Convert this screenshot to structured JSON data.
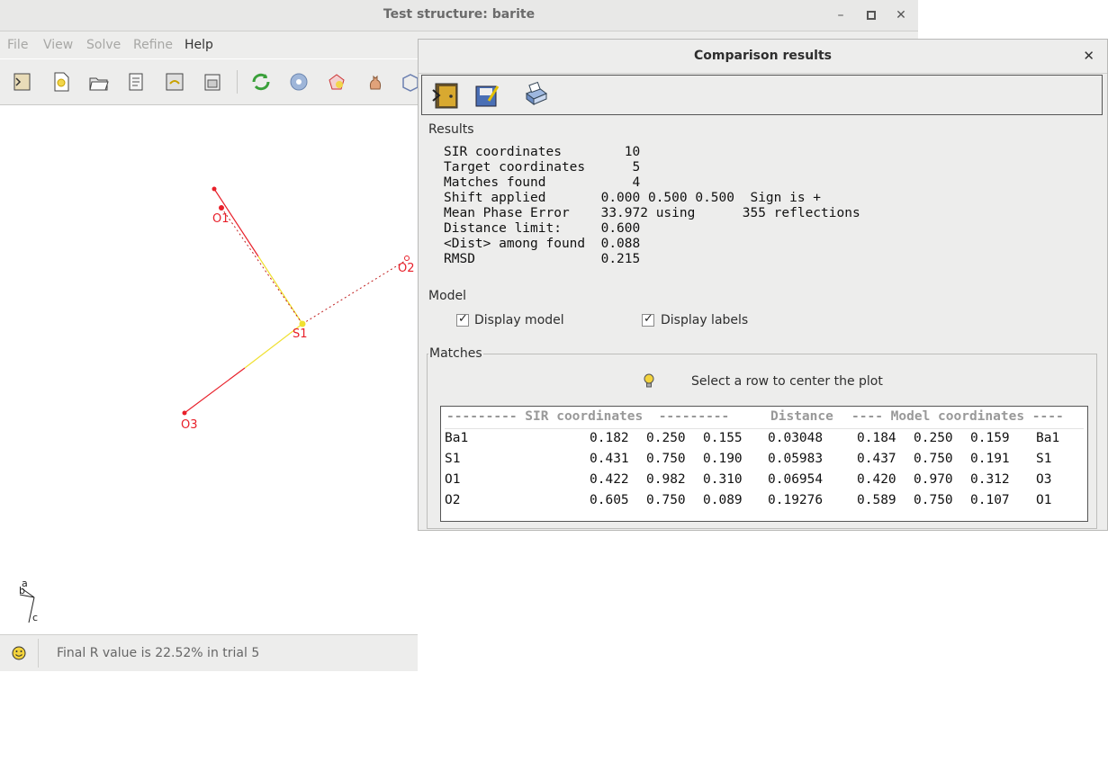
{
  "main_window": {
    "title": "Test structure: barite",
    "menu": [
      "File",
      "View",
      "Solve",
      "Refine",
      "Help"
    ],
    "status_text": "Final R value is 22.52% in trial 5"
  },
  "canvas": {
    "atoms": [
      "O1",
      "O2",
      "S1",
      "O3"
    ],
    "axes": [
      "a",
      "b",
      "c"
    ]
  },
  "dialog": {
    "title": "Comparison results",
    "results_label": "Results",
    "results": [
      "SIR coordinates        10",
      "Target coordinates      5",
      "Matches found           4",
      "Shift applied       0.000 0.500 0.500  Sign is +",
      "Mean Phase Error    33.972 using      355 reflections",
      "Distance limit:     0.600",
      "<Dist> among found  0.088",
      "RMSD                0.215"
    ],
    "model_label": "Model",
    "display_model": "Display model",
    "display_labels": "Display labels",
    "matches_label": "Matches",
    "hint": "Select a row to center the plot",
    "table": {
      "header_sir": "--------- SIR coordinates  ---------",
      "header_dist": "Distance",
      "header_model": "---- Model coordinates ----",
      "rows": [
        {
          "atom": "Ba1",
          "x": "0.182",
          "y": "0.250",
          "z": "0.155",
          "dist": "0.03048",
          "mx": "0.184",
          "my": "0.250",
          "mz": "0.159",
          "matom": "Ba1"
        },
        {
          "atom": "S1",
          "x": "0.431",
          "y": "0.750",
          "z": "0.190",
          "dist": "0.05983",
          "mx": "0.437",
          "my": "0.750",
          "mz": "0.191",
          "matom": "S1"
        },
        {
          "atom": "O1",
          "x": "0.422",
          "y": "0.982",
          "z": "0.310",
          "dist": "0.06954",
          "mx": "0.420",
          "my": "0.970",
          "mz": "0.312",
          "matom": "O3"
        },
        {
          "atom": "O2",
          "x": "0.605",
          "y": "0.750",
          "z": "0.089",
          "dist": "0.19276",
          "mx": "0.589",
          "my": "0.750",
          "mz": "0.107",
          "matom": "O1"
        }
      ]
    }
  }
}
